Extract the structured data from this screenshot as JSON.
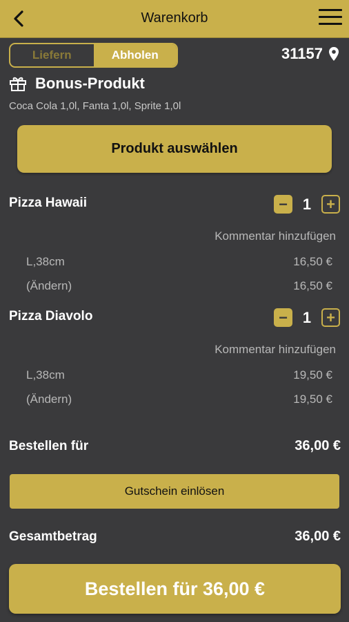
{
  "header": {
    "title": "Warenkorb",
    "back_icon": "chevron-left-icon",
    "menu_icon": "hamburger-menu-icon"
  },
  "mode_toggle": {
    "options": [
      "Liefern",
      "Abholen"
    ],
    "selected": "Abholen"
  },
  "location": {
    "postal_code": "31157",
    "icon": "location-pin-icon"
  },
  "bonus": {
    "icon": "gift-icon",
    "title": "Bonus-Produkt",
    "subtitle": "Coca Cola 1,0l, Fanta 1,0l, Sprite 1,0l",
    "button_label": "Produkt auswählen"
  },
  "cart": {
    "items": [
      {
        "name": "Pizza Hawaii",
        "quantity": "1",
        "comment_label": "Kommentar hinzufügen",
        "details": [
          {
            "label": "L,38cm",
            "price": "16,50 €"
          },
          {
            "label": "(Ändern)",
            "price": "16,50 €"
          }
        ]
      },
      {
        "name": "Pizza Diavolo",
        "quantity": "1",
        "comment_label": "Kommentar hinzufügen",
        "details": [
          {
            "label": "L,38cm",
            "price": "19,50 €"
          },
          {
            "label": "(Ändern)",
            "price": "19,50 €"
          }
        ]
      }
    ]
  },
  "summary": {
    "order_label": "Bestellen für",
    "order_value": "36,00 €",
    "voucher_button": "Gutschein einlösen",
    "total_label": "Gesamtbetrag",
    "total_value": "36,00 €"
  },
  "checkout": {
    "button_label": "Bestellen für 36,00 €"
  },
  "colors": {
    "accent": "#c9b04b",
    "background": "#3a3a3c"
  }
}
